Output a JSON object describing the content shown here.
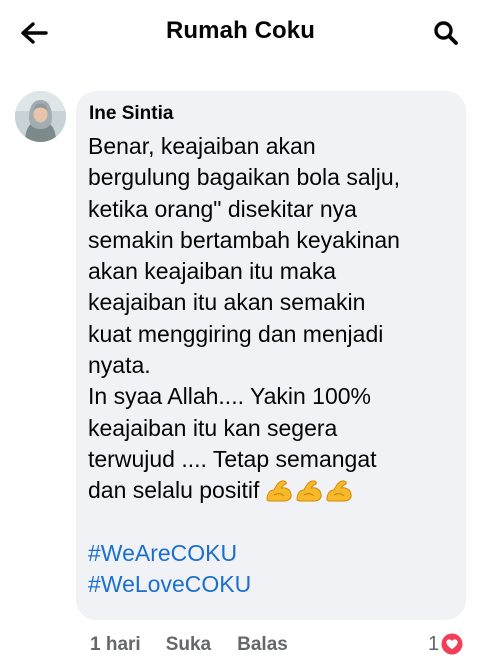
{
  "header": {
    "title": "Rumah Coku",
    "back_icon": "arrow-left-icon",
    "search_icon": "search-icon"
  },
  "comment": {
    "author": "Ine Sintia",
    "lines": [
      "Benar, keajaiban akan",
      "bergulung bagaikan bola salju,",
      "ketika orang\" disekitar nya",
      "semakin bertambah keyakinan",
      "akan keajaiban itu maka",
      "keajaiban itu akan semakin",
      "kuat menggiring dan menjadi",
      "nyata.",
      "In syaa Allah.... Yakin 100%",
      "keajaiban itu kan segera",
      "terwujud .... Tetap semangat",
      "dan selalu positif"
    ],
    "emoji": [
      "flexed-biceps",
      "flexed-biceps",
      "flexed-biceps"
    ],
    "hashtags": [
      "#WeAreCOKU",
      "#WeLoveCOKU"
    ],
    "time": "1 hari",
    "like_label": "Suka",
    "reply_label": "Balas",
    "reaction_count": "1",
    "reaction_icon": "love-reaction-icon"
  },
  "colors": {
    "bubble": "#f0f2f5",
    "hashtag": "#1b6fd0",
    "meta_text": "#65676b",
    "love": "#f33e58"
  }
}
